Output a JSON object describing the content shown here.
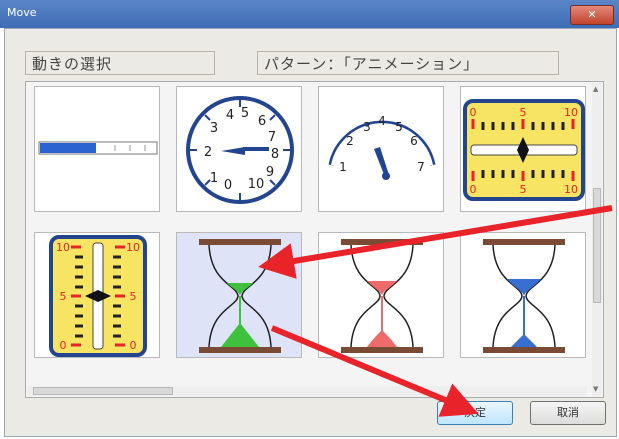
{
  "window": {
    "title": "Move",
    "close_glyph": "✕"
  },
  "labels": {
    "selection": "動きの選択",
    "pattern": "パターン：「アニメーション」"
  },
  "options": [
    {
      "name": "progress-bar",
      "selected": false
    },
    {
      "name": "clock-dial",
      "selected": false,
      "ticks": [
        "1",
        "2",
        "3",
        "4",
        "5",
        "6",
        "7",
        "8",
        "9",
        "10",
        "0"
      ]
    },
    {
      "name": "speedometer",
      "selected": false,
      "ticks": [
        "1",
        "2",
        "3",
        "4",
        "5",
        "6",
        "7"
      ]
    },
    {
      "name": "horizontal-slider-gauge",
      "selected": false,
      "ticks": [
        "0",
        "5",
        "10",
        "0",
        "5",
        "10"
      ]
    },
    {
      "name": "vertical-slider-gauge",
      "selected": false,
      "ticks": [
        "10",
        "5",
        "0",
        "10",
        "5",
        "0"
      ]
    },
    {
      "name": "hourglass",
      "color": "#3ec23e",
      "selected": true
    },
    {
      "name": "hourglass",
      "color": "#ef6a6a",
      "selected": false
    },
    {
      "name": "hourglass",
      "color": "#3a6fd2",
      "selected": false
    }
  ],
  "buttons": {
    "ok_label": "決定",
    "cancel_label": "取消"
  },
  "colors": {
    "accent_arrow": "#e8232a",
    "gauge_fill": "#f7e463",
    "dial_blue": "#23448f"
  }
}
